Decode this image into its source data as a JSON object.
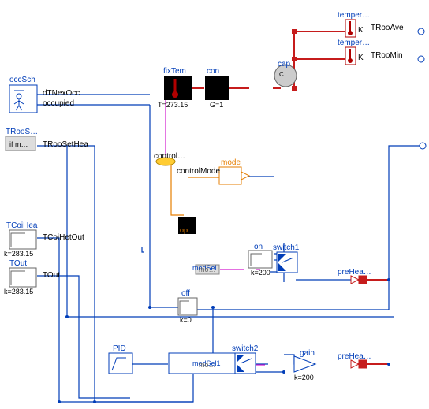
{
  "blocks": {
    "occSch": {
      "label": "occSch",
      "outputs": [
        "dTNexOcc",
        "occupied"
      ]
    },
    "fixTem": {
      "label": "fixTem",
      "param": "T=273.15"
    },
    "con": {
      "label": "con",
      "param": "G=1"
    },
    "cap": {
      "label": "cap",
      "param": "C..."
    },
    "temperA": {
      "label": "temper…",
      "unit": "K",
      "out": "TRooAve"
    },
    "temperB": {
      "label": "temper…",
      "unit": "K",
      "out": "TRooMin"
    },
    "TRooS": {
      "label": "TRooS…",
      "param": "if m…",
      "out": "TRooSetHea"
    },
    "control": {
      "label": "control…",
      "sub": "controlMode"
    },
    "mode": {
      "label": "mode"
    },
    "op": {
      "label": "op…",
      "sq": "="
    },
    "TCoiHea": {
      "label": "TCoiHea",
      "param": "k=283.15",
      "out": "TCoiHetOut"
    },
    "TCoiOn": {
      "label": "on",
      "param": "k=200"
    },
    "TOut": {
      "label": "TOut",
      "param": "k=283.15",
      "out": "TOut"
    },
    "off": {
      "label": "off",
      "param": "k=0"
    },
    "modSel": {
      "label": "modSel",
      "sub": "mo…"
    },
    "switch1": {
      "label": "switch1"
    },
    "preHeaA": {
      "label": "preHea…"
    },
    "PID": {
      "label": "PID"
    },
    "modSel1": {
      "label": "modSel1",
      "sub": "mo…"
    },
    "switch2": {
      "label": "switch2"
    },
    "gain": {
      "label": "gain",
      "param": "k=200"
    },
    "preHeaB": {
      "label": "preHea…"
    }
  }
}
